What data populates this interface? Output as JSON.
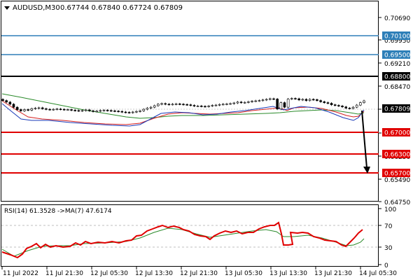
{
  "header": {
    "symbol_tf": "AUDUSD,M30",
    "ohlc": "0.67744 0.67840 0.67724 0.67809"
  },
  "indicator": {
    "label": "RSI(14) 61.3528  ->MA(7) 47.6174",
    "rsi_color": "#e00000",
    "ma_color": "#2a8a2a",
    "levels": [
      70,
      30
    ],
    "scale_ticks": [
      "100",
      "70",
      "30",
      "0"
    ]
  },
  "price_axis": {
    "ticks": [
      "0.70690",
      "0.69950",
      "0.69210",
      "0.68470",
      "0.67730",
      "0.66990",
      "0.66250",
      "0.65490",
      "0.64750"
    ]
  },
  "levels": [
    {
      "label": "0.70100",
      "color": "#2e7fb8",
      "fill": "#2e7fb8"
    },
    {
      "label": "0.69500",
      "color": "#2e7fb8",
      "fill": "#2e7fb8"
    },
    {
      "label": "0.68800",
      "color": "#000000",
      "fill": "#000000"
    },
    {
      "label": "0.67000",
      "color": "#e00000",
      "fill": "#e00000"
    },
    {
      "label": "0.66300",
      "color": "#e00000",
      "fill": "#e00000"
    },
    {
      "label": "0.65700",
      "color": "#e00000",
      "fill": "#e00000"
    }
  ],
  "current_price": {
    "label": "0.67809",
    "fill": "#000000"
  },
  "time_axis": {
    "labels": [
      "11 Jul 2022",
      "11 Jul 21:30",
      "12 Jul 05:30",
      "12 Jul 13:30",
      "12 Jul 21:30",
      "13 Jul 05:30",
      "13 Jul 13:30",
      "13 Jul 21:30",
      "14 Jul 05:30"
    ]
  },
  "chart_data": {
    "type": "candlestick",
    "symbol": "AUDUSD",
    "timeframe": "M30",
    "ylim": [
      0.645,
      0.711
    ],
    "closes": [
      0.6782,
      0.6777,
      0.677,
      0.676,
      0.6752,
      0.6748,
      0.6752,
      0.675,
      0.6755,
      0.6757,
      0.6758,
      0.6755,
      0.6753,
      0.6752,
      0.6753,
      0.6754,
      0.6753,
      0.6752,
      0.6752,
      0.675,
      0.6749,
      0.6748,
      0.6749,
      0.6751,
      0.6748,
      0.6746,
      0.6747,
      0.6749,
      0.675,
      0.6749,
      0.6748,
      0.6747,
      0.6746,
      0.6744,
      0.6743,
      0.6742,
      0.6744,
      0.6746,
      0.6748,
      0.6753,
      0.6757,
      0.676,
      0.6765,
      0.677,
      0.6772,
      0.677,
      0.6769,
      0.677,
      0.6771,
      0.677,
      0.6769,
      0.6768,
      0.6766,
      0.6764,
      0.6764,
      0.6763,
      0.6762,
      0.6764,
      0.6766,
      0.6767,
      0.6769,
      0.677,
      0.6771,
      0.6772,
      0.6774,
      0.6777,
      0.6775,
      0.6776,
      0.6778,
      0.678,
      0.6781,
      0.6782,
      0.6784,
      0.6786,
      0.6788,
      0.6787,
      0.6754,
      0.6775,
      0.676,
      0.6787,
      0.6789,
      0.6788,
      0.6784,
      0.6786,
      0.6782,
      0.6786,
      0.6785,
      0.6782,
      0.6778,
      0.6775,
      0.6773,
      0.6768,
      0.6766,
      0.6764,
      0.6761,
      0.6757,
      0.6756,
      0.676,
      0.6767,
      0.6775,
      0.6781
    ]
  }
}
